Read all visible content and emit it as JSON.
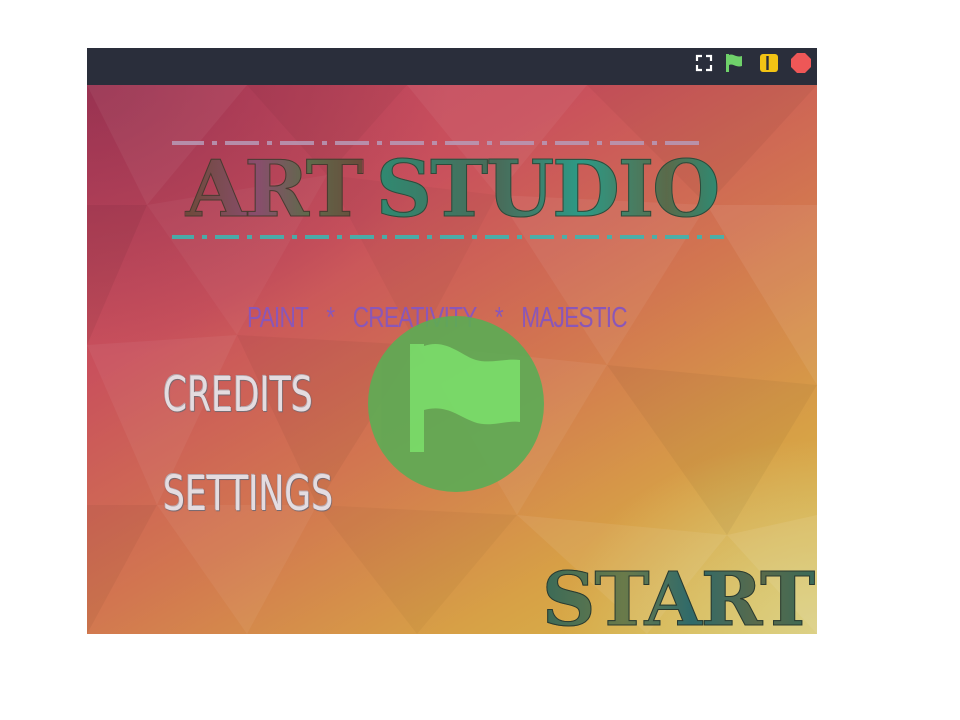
{
  "player": {
    "controls": {
      "fullscreen_icon": "fullscreen-icon",
      "green_flag_icon": "green-flag-icon",
      "pause_icon": "pause-icon",
      "stop_icon": "stop-icon"
    },
    "colors": {
      "topbar": "#2a2e3b",
      "flag_green": "#6fd16a",
      "pause_yellow": "#f2c314",
      "stop_red": "#ee5757",
      "overlay_circle": "#5eab55"
    }
  },
  "game": {
    "title_word1": "ART",
    "title_word2": "STUDIO",
    "tagline": {
      "item1": "PAINT",
      "sep1": "*",
      "item2": "CREATIVITY",
      "sep2": "*",
      "item3": "MAJESTIC"
    },
    "menu": {
      "credits": "CREDITS",
      "settings": "SETTINGS",
      "start": "START"
    },
    "overlay_icon": "green-flag-icon"
  }
}
